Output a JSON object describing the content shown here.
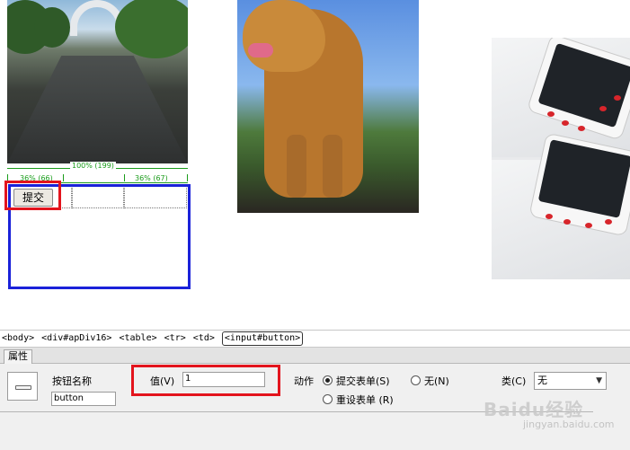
{
  "canvas": {
    "ruler": {
      "full_width": "100% (199)",
      "col1": "36% (66)",
      "col3": "36% (67)"
    },
    "submit_button": "提交"
  },
  "tag_selector": {
    "tags": [
      "<body>",
      "<div#apDiv16>",
      "<table>",
      "<tr>",
      "<td>",
      "<input#button>"
    ]
  },
  "properties": {
    "tab_label": "属性",
    "button_name_label": "按钮名称",
    "button_name_value": "button",
    "value_label": "值(V)",
    "value_input": "1",
    "action_label": "动作",
    "action_submit": "提交表单(S)",
    "action_none": "无(N)",
    "action_reset": "重设表单 (R)",
    "class_label": "类(C)",
    "class_value": "无"
  },
  "watermark": {
    "brand": "Baidu经验",
    "url": "jingyan.baidu.com"
  },
  "colors": {
    "highlight_red": "#e3141d",
    "highlight_blue": "#1a22d9",
    "ruler_green": "#1b9c1b"
  }
}
